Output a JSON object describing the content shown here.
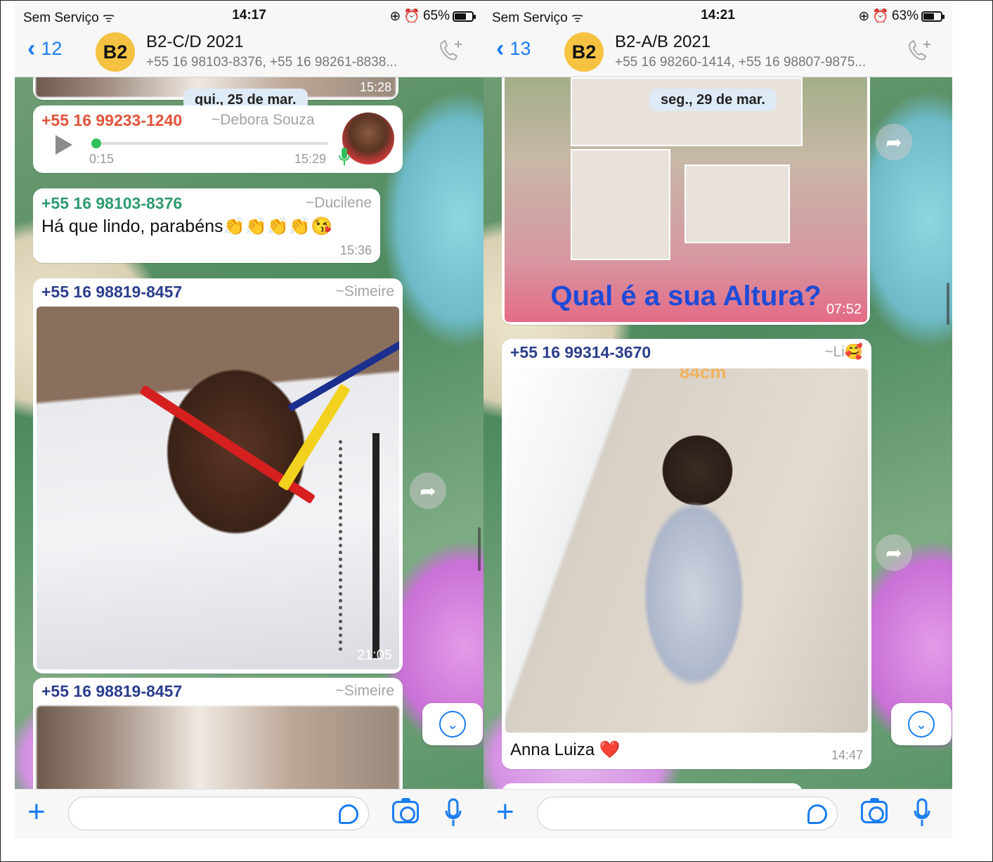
{
  "left": {
    "status": {
      "carrier": "Sem Serviço",
      "time": "14:17",
      "battery": "65%",
      "battery_level": 0.65
    },
    "header": {
      "back_count": "12",
      "avatar": "B2",
      "title": "B2-C/D 2021",
      "subtitle": "+55 16 98103-8376, +55 16 98261-8838..."
    },
    "prev_time": "15:28",
    "date_pill": "qui., 25 de mar.",
    "audio": {
      "sender": "+55 16 99233-1240",
      "alias": "~Debora Souza",
      "duration": "0:15",
      "time": "15:29",
      "progress": 0.01
    },
    "text_msg": {
      "sender": "+55 16 98103-8376",
      "alias": "~Ducilene",
      "text": "Há que lindo, parabéns👏👏👏👏😘",
      "time": "15:36"
    },
    "photo_msg": {
      "sender": "+55 16 98819-8457",
      "alias": "~Simeire",
      "time": "21:05"
    },
    "photo_msg2": {
      "sender": "+55 16 98819-8457",
      "alias": "~Simeire"
    }
  },
  "right": {
    "status": {
      "carrier": "Sem Serviço",
      "time": "14:21",
      "battery": "63%",
      "battery_level": 0.63
    },
    "header": {
      "back_count": "13",
      "avatar": "B2",
      "title": "B2-A/B 2021",
      "subtitle": "+55 16 98260-1414, +55 16 98807-9875..."
    },
    "date_pill": "seg., 29 de mar.",
    "collage": {
      "caption": "Qual é  a sua Altura?",
      "time": "07:52"
    },
    "photo_msg": {
      "sender": "+55 16 99314-3670",
      "alias": "~Li🥰",
      "caption": "Anna Luiza ❤️",
      "time": "14:47",
      "overlay": "84cm"
    }
  },
  "colors": {
    "accent": "#1a7df0",
    "sender_red": "#e2533a",
    "sender_green": "#2f9a6f",
    "sender_navy": "#2b3e8c",
    "mic_green": "#30c05a"
  }
}
